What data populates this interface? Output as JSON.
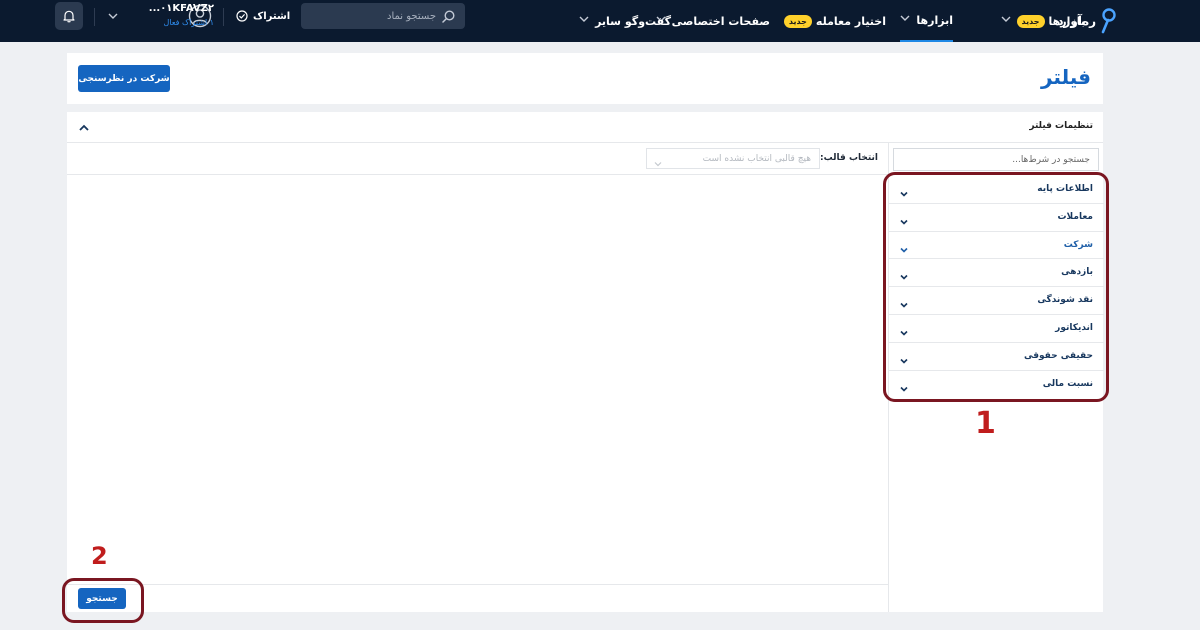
{
  "nav": {
    "brand": "ره‌آورد",
    "markets": "بازارها",
    "markets_badge": "جدید",
    "tools": "ابزارها",
    "option": "اختیار معامله",
    "option_badge": "جدید",
    "pages": "صفحات اختصاصی",
    "chat": "گفت‌وگو",
    "other": "سایر",
    "search_placeholder": "جستجو نماد",
    "subscription": "اشتراک",
    "user_name": "۰۱KFAVZ۲...",
    "user_status": "۱ اشتراک فعال"
  },
  "header": {
    "title": "فیلتر",
    "survey_button": "شرکت در نظرسنجی"
  },
  "settings": {
    "title": "تنظیمات فیلتر",
    "search_placeholder": "جستجو در شرط‌ها...",
    "template_label": "انتخاب قالب:",
    "template_value": "هیچ قالبی انتخاب نشده است",
    "search_button": "جستجو",
    "conditions": [
      {
        "label": "اطلاعات پایه"
      },
      {
        "label": "معاملات"
      },
      {
        "label": "شرکت"
      },
      {
        "label": "بازدهی"
      },
      {
        "label": "نقد شوندگی"
      },
      {
        "label": "اندیکاتور"
      },
      {
        "label": "حقیقی حقوقی"
      },
      {
        "label": "نسبت مالی"
      }
    ]
  },
  "annotations": {
    "one": "1",
    "two": "2"
  },
  "colors": {
    "navbar": "#0b1a2f",
    "accent": "#1565c0",
    "badge": "#ffd12b",
    "annotation": "#7a1621"
  }
}
